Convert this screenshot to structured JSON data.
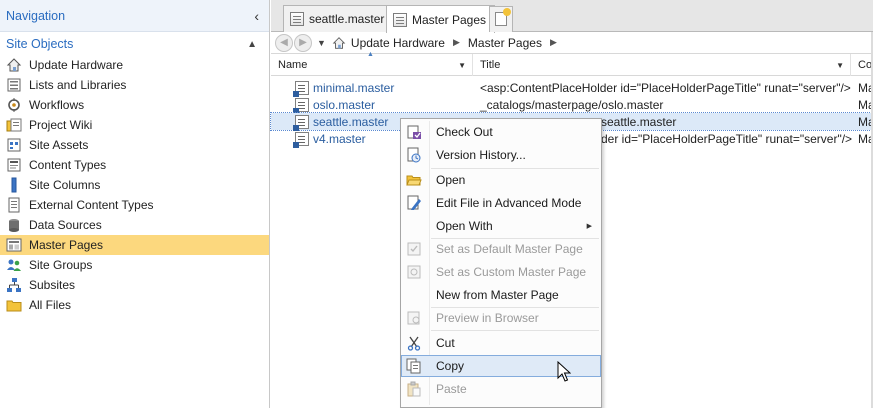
{
  "navigation": {
    "title": "Navigation",
    "collapse_glyph": "‹",
    "section_title": "Site Objects",
    "section_caret": "▲",
    "items": [
      {
        "label": "Update Hardware",
        "icon": "site-home-icon"
      },
      {
        "label": "Lists and Libraries",
        "icon": "list-icon"
      },
      {
        "label": "Workflows",
        "icon": "workflow-icon"
      },
      {
        "label": "Project Wiki",
        "icon": "wiki-icon"
      },
      {
        "label": "Site Assets",
        "icon": "assets-icon"
      },
      {
        "label": "Content Types",
        "icon": "content-types-icon"
      },
      {
        "label": "Site Columns",
        "icon": "site-columns-icon"
      },
      {
        "label": "External Content Types",
        "icon": "external-content-icon"
      },
      {
        "label": "Data Sources",
        "icon": "data-sources-icon"
      },
      {
        "label": "Master Pages",
        "icon": "master-pages-icon",
        "selected": true
      },
      {
        "label": "Site Groups",
        "icon": "site-groups-icon"
      },
      {
        "label": "Subsites",
        "icon": "subsites-icon"
      },
      {
        "label": "All Files",
        "icon": "folder-icon"
      }
    ]
  },
  "tabs": [
    {
      "label": "seattle.master",
      "active": false
    },
    {
      "label": "Master Pages",
      "active": true
    }
  ],
  "breadcrumb": {
    "items": [
      "Update Hardware",
      "Master Pages"
    ],
    "separator": "▶"
  },
  "columns": {
    "name": "Name",
    "title": "Title",
    "extra": "Co"
  },
  "files": [
    {
      "name": "minimal.master",
      "title": "<asp:ContentPlaceHolder id=\"PlaceHolderPageTitle\" runat=\"server\"/>",
      "extra": "Ma",
      "selected": false
    },
    {
      "name": "oslo.master",
      "title": "_catalogs/masterpage/oslo.master",
      "extra": "Ma",
      "selected": false
    },
    {
      "name": "seattle.master",
      "title": "seattle.master",
      "extra": "Ma",
      "selected": true
    },
    {
      "name": "v4.master",
      "title": "der id=\"PlaceHolderPageTitle\" runat=\"server\"/>",
      "extra": "Ma",
      "selected": false
    }
  ],
  "context_menu": {
    "items": [
      {
        "label": "Check Out",
        "icon": "check-out-icon",
        "disabled": false
      },
      {
        "label": "Version History...",
        "icon": "version-history-icon",
        "disabled": false
      },
      {
        "label": "Open",
        "icon": "open-folder-icon",
        "disabled": false
      },
      {
        "label": "Edit File in Advanced Mode",
        "icon": "edit-file-icon",
        "disabled": false
      },
      {
        "label": "Open With",
        "icon": "",
        "disabled": false,
        "submenu": true
      },
      {
        "label": "Set as Default Master Page",
        "icon": "default-master-icon",
        "disabled": true
      },
      {
        "label": "Set as Custom Master Page",
        "icon": "custom-master-icon",
        "disabled": true
      },
      {
        "label": "New from Master Page",
        "icon": "",
        "disabled": false
      },
      {
        "label": "Preview in Browser",
        "icon": "preview-browser-icon",
        "disabled": true
      },
      {
        "label": "Cut",
        "icon": "cut-icon",
        "disabled": false
      },
      {
        "label": "Copy",
        "icon": "copy-icon",
        "disabled": false,
        "hover": true
      },
      {
        "label": "Paste",
        "icon": "paste-icon",
        "disabled": true
      }
    ]
  },
  "colors": {
    "accent": "#2a6cc0",
    "selection": "#fcd87e",
    "row_selection": "#dce9f8",
    "menu_hover": "#dfeaf7"
  }
}
